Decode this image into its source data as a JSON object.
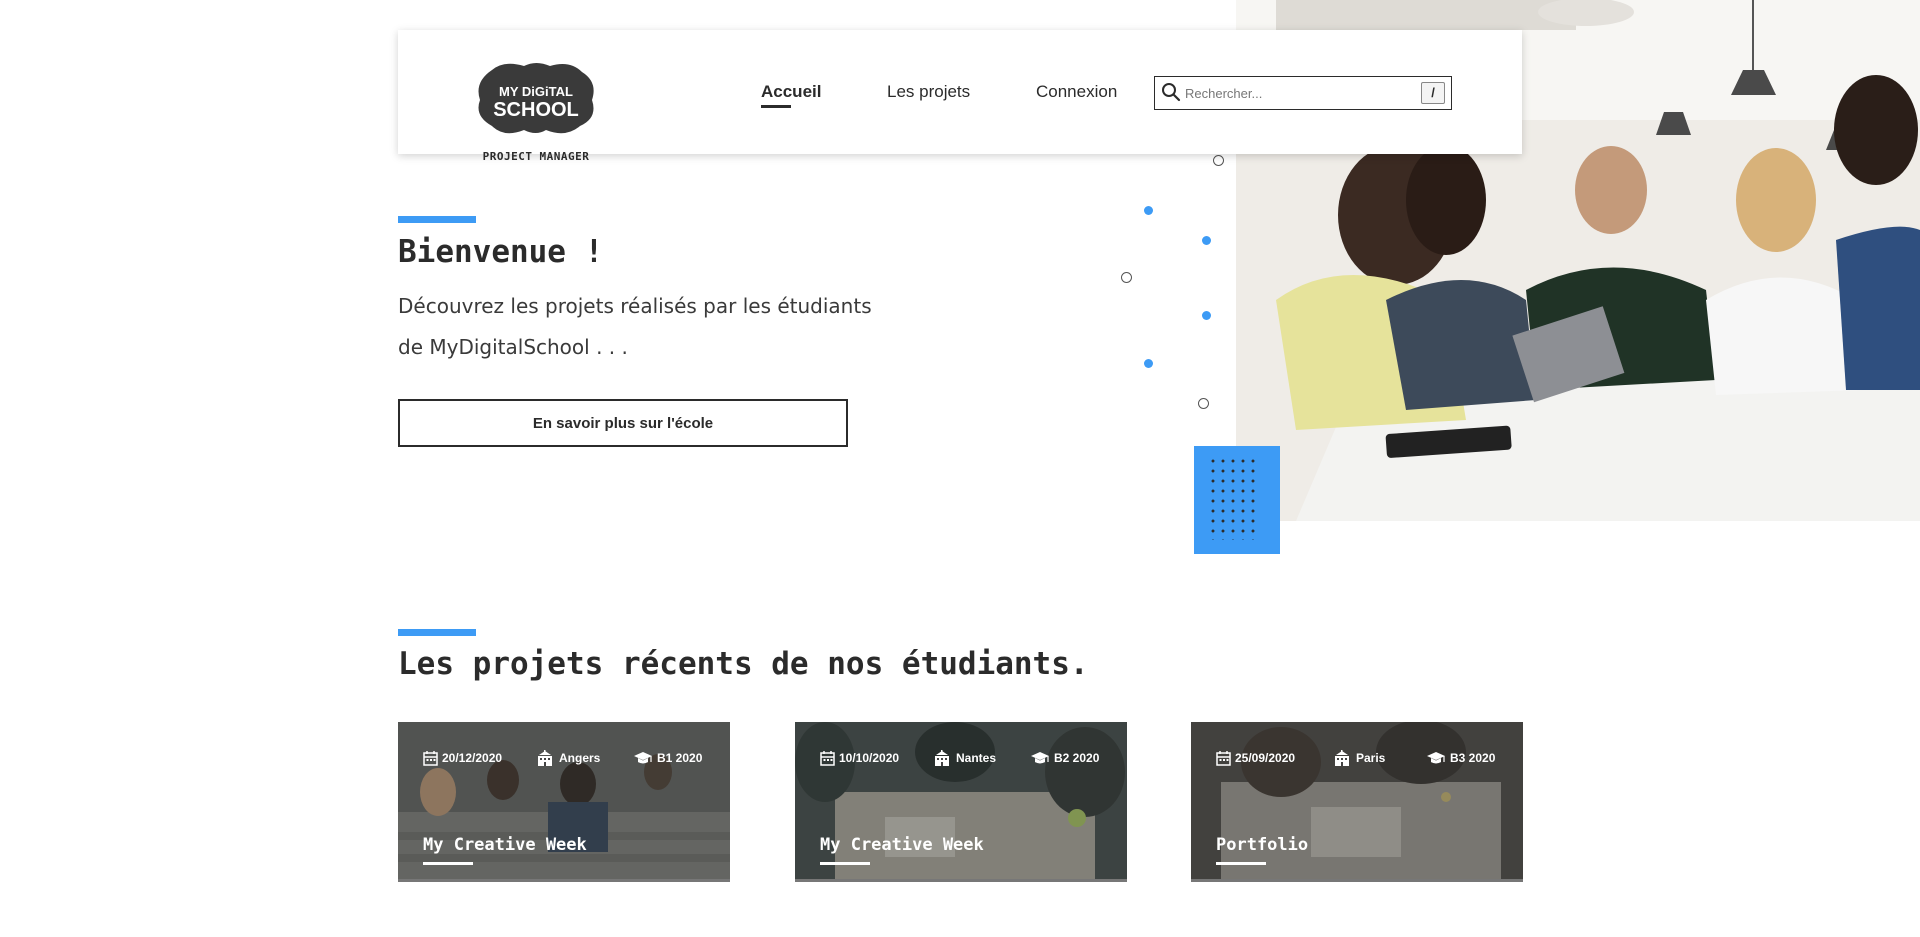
{
  "brand": {
    "logo_line1": "MY DiGiTAL",
    "logo_line2": "SCHOOL",
    "caption": "PROJECT MANAGER"
  },
  "nav": {
    "items": [
      {
        "label": "Accueil",
        "active": true
      },
      {
        "label": "Les projets",
        "active": false
      },
      {
        "label": "Connexion",
        "active": false
      }
    ]
  },
  "search": {
    "placeholder": "Rechercher...",
    "shortcut": "/",
    "icon": "search-icon"
  },
  "hero": {
    "title": "Bienvenue !",
    "text": "Découvrez les projets réalisés par les étudiants de MyDigitalSchool . . .",
    "button_label": "En savoir plus sur l'école"
  },
  "recent": {
    "title": "Les projets récents de nos étudiants.",
    "projects": [
      {
        "date": "20/12/2020",
        "city": "Angers",
        "level": "B1 2020",
        "title": "My Creative Week"
      },
      {
        "date": "10/10/2020",
        "city": "Nantes",
        "level": "B2 2020",
        "title": "My Creative Week"
      },
      {
        "date": "25/09/2020",
        "city": "Paris",
        "level": "B3 2020",
        "title": "Portfolio"
      }
    ]
  },
  "colors": {
    "accent": "#3d9bf5",
    "text": "#2b2b2b"
  }
}
